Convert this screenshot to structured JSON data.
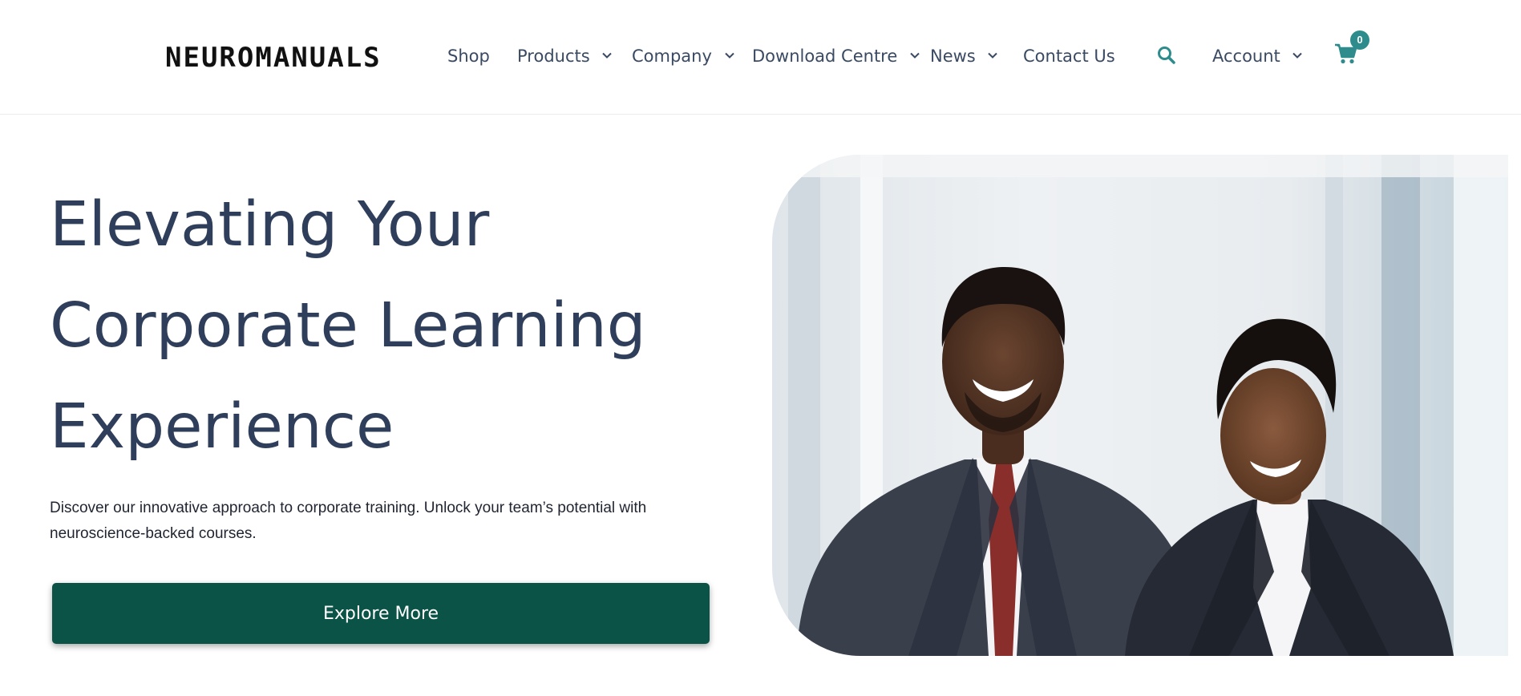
{
  "header": {
    "logo": "NEUROMANUALS",
    "nav": [
      {
        "label": "Shop"
      },
      {
        "label": "Products"
      },
      {
        "label": "Company"
      },
      {
        "label": "Download Centre"
      },
      {
        "label": "News"
      },
      {
        "label": "Contact Us"
      }
    ],
    "account_label": "Account",
    "cart_count": "0",
    "icons": {
      "search": "search-icon",
      "cart": "cart-icon",
      "chevron": "chevron-down-icon"
    },
    "accent_color": "#2e8c8c"
  },
  "hero": {
    "title_lines": [
      "Elevating Your",
      "Corporate Learning",
      "Experience"
    ],
    "description": "Discover our innovative approach to corporate training. Unlock your team’s potential with neuroscience-backed courses.",
    "cta_label": "Explore More",
    "cta_color": "#0b5347",
    "title_color": "#2f3e5a"
  }
}
